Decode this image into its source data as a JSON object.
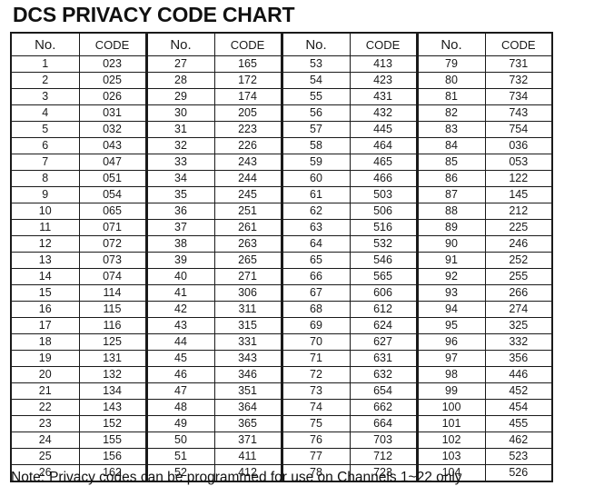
{
  "page": {
    "title": "DCS PRIVACY CODE CHART"
  },
  "table": {
    "headers": [
      "No.",
      "CODE",
      "No.",
      "CODE",
      "No.",
      "CODE",
      "No.",
      "CODE"
    ],
    "rows": [
      [
        "1",
        "023",
        "27",
        "165",
        "53",
        "413",
        "79",
        "731"
      ],
      [
        "2",
        "025",
        "28",
        "172",
        "54",
        "423",
        "80",
        "732"
      ],
      [
        "3",
        "026",
        "29",
        "174",
        "55",
        "431",
        "81",
        "734"
      ],
      [
        "4",
        "031",
        "30",
        "205",
        "56",
        "432",
        "82",
        "743"
      ],
      [
        "5",
        "032",
        "31",
        "223",
        "57",
        "445",
        "83",
        "754"
      ],
      [
        "6",
        "043",
        "32",
        "226",
        "58",
        "464",
        "84",
        "036"
      ],
      [
        "7",
        "047",
        "33",
        "243",
        "59",
        "465",
        "85",
        "053"
      ],
      [
        "8",
        "051",
        "34",
        "244",
        "60",
        "466",
        "86",
        "122"
      ],
      [
        "9",
        "054",
        "35",
        "245",
        "61",
        "503",
        "87",
        "145"
      ],
      [
        "10",
        "065",
        "36",
        "251",
        "62",
        "506",
        "88",
        "212"
      ],
      [
        "11",
        "071",
        "37",
        "261",
        "63",
        "516",
        "89",
        "225"
      ],
      [
        "12",
        "072",
        "38",
        "263",
        "64",
        "532",
        "90",
        "246"
      ],
      [
        "13",
        "073",
        "39",
        "265",
        "65",
        "546",
        "91",
        "252"
      ],
      [
        "14",
        "074",
        "40",
        "271",
        "66",
        "565",
        "92",
        "255"
      ],
      [
        "15",
        "114",
        "41",
        "306",
        "67",
        "606",
        "93",
        "266"
      ],
      [
        "16",
        "115",
        "42",
        "311",
        "68",
        "612",
        "94",
        "274"
      ],
      [
        "17",
        "116",
        "43",
        "315",
        "69",
        "624",
        "95",
        "325"
      ],
      [
        "18",
        "125",
        "44",
        "331",
        "70",
        "627",
        "96",
        "332"
      ],
      [
        "19",
        "131",
        "45",
        "343",
        "71",
        "631",
        "97",
        "356"
      ],
      [
        "20",
        "132",
        "46",
        "346",
        "72",
        "632",
        "98",
        "446"
      ],
      [
        "21",
        "134",
        "47",
        "351",
        "73",
        "654",
        "99",
        "452"
      ],
      [
        "22",
        "143",
        "48",
        "364",
        "74",
        "662",
        "100",
        "454"
      ],
      [
        "23",
        "152",
        "49",
        "365",
        "75",
        "664",
        "101",
        "455"
      ],
      [
        "24",
        "155",
        "50",
        "371",
        "76",
        "703",
        "102",
        "462"
      ],
      [
        "25",
        "156",
        "51",
        "411",
        "77",
        "712",
        "103",
        "523"
      ],
      [
        "26",
        "162",
        "52",
        "412",
        "78",
        "723",
        "104",
        "526"
      ]
    ]
  },
  "footer": {
    "label": "Note:",
    "text": "Privacy codes can be programmed for use on Channels 1~22 only"
  }
}
